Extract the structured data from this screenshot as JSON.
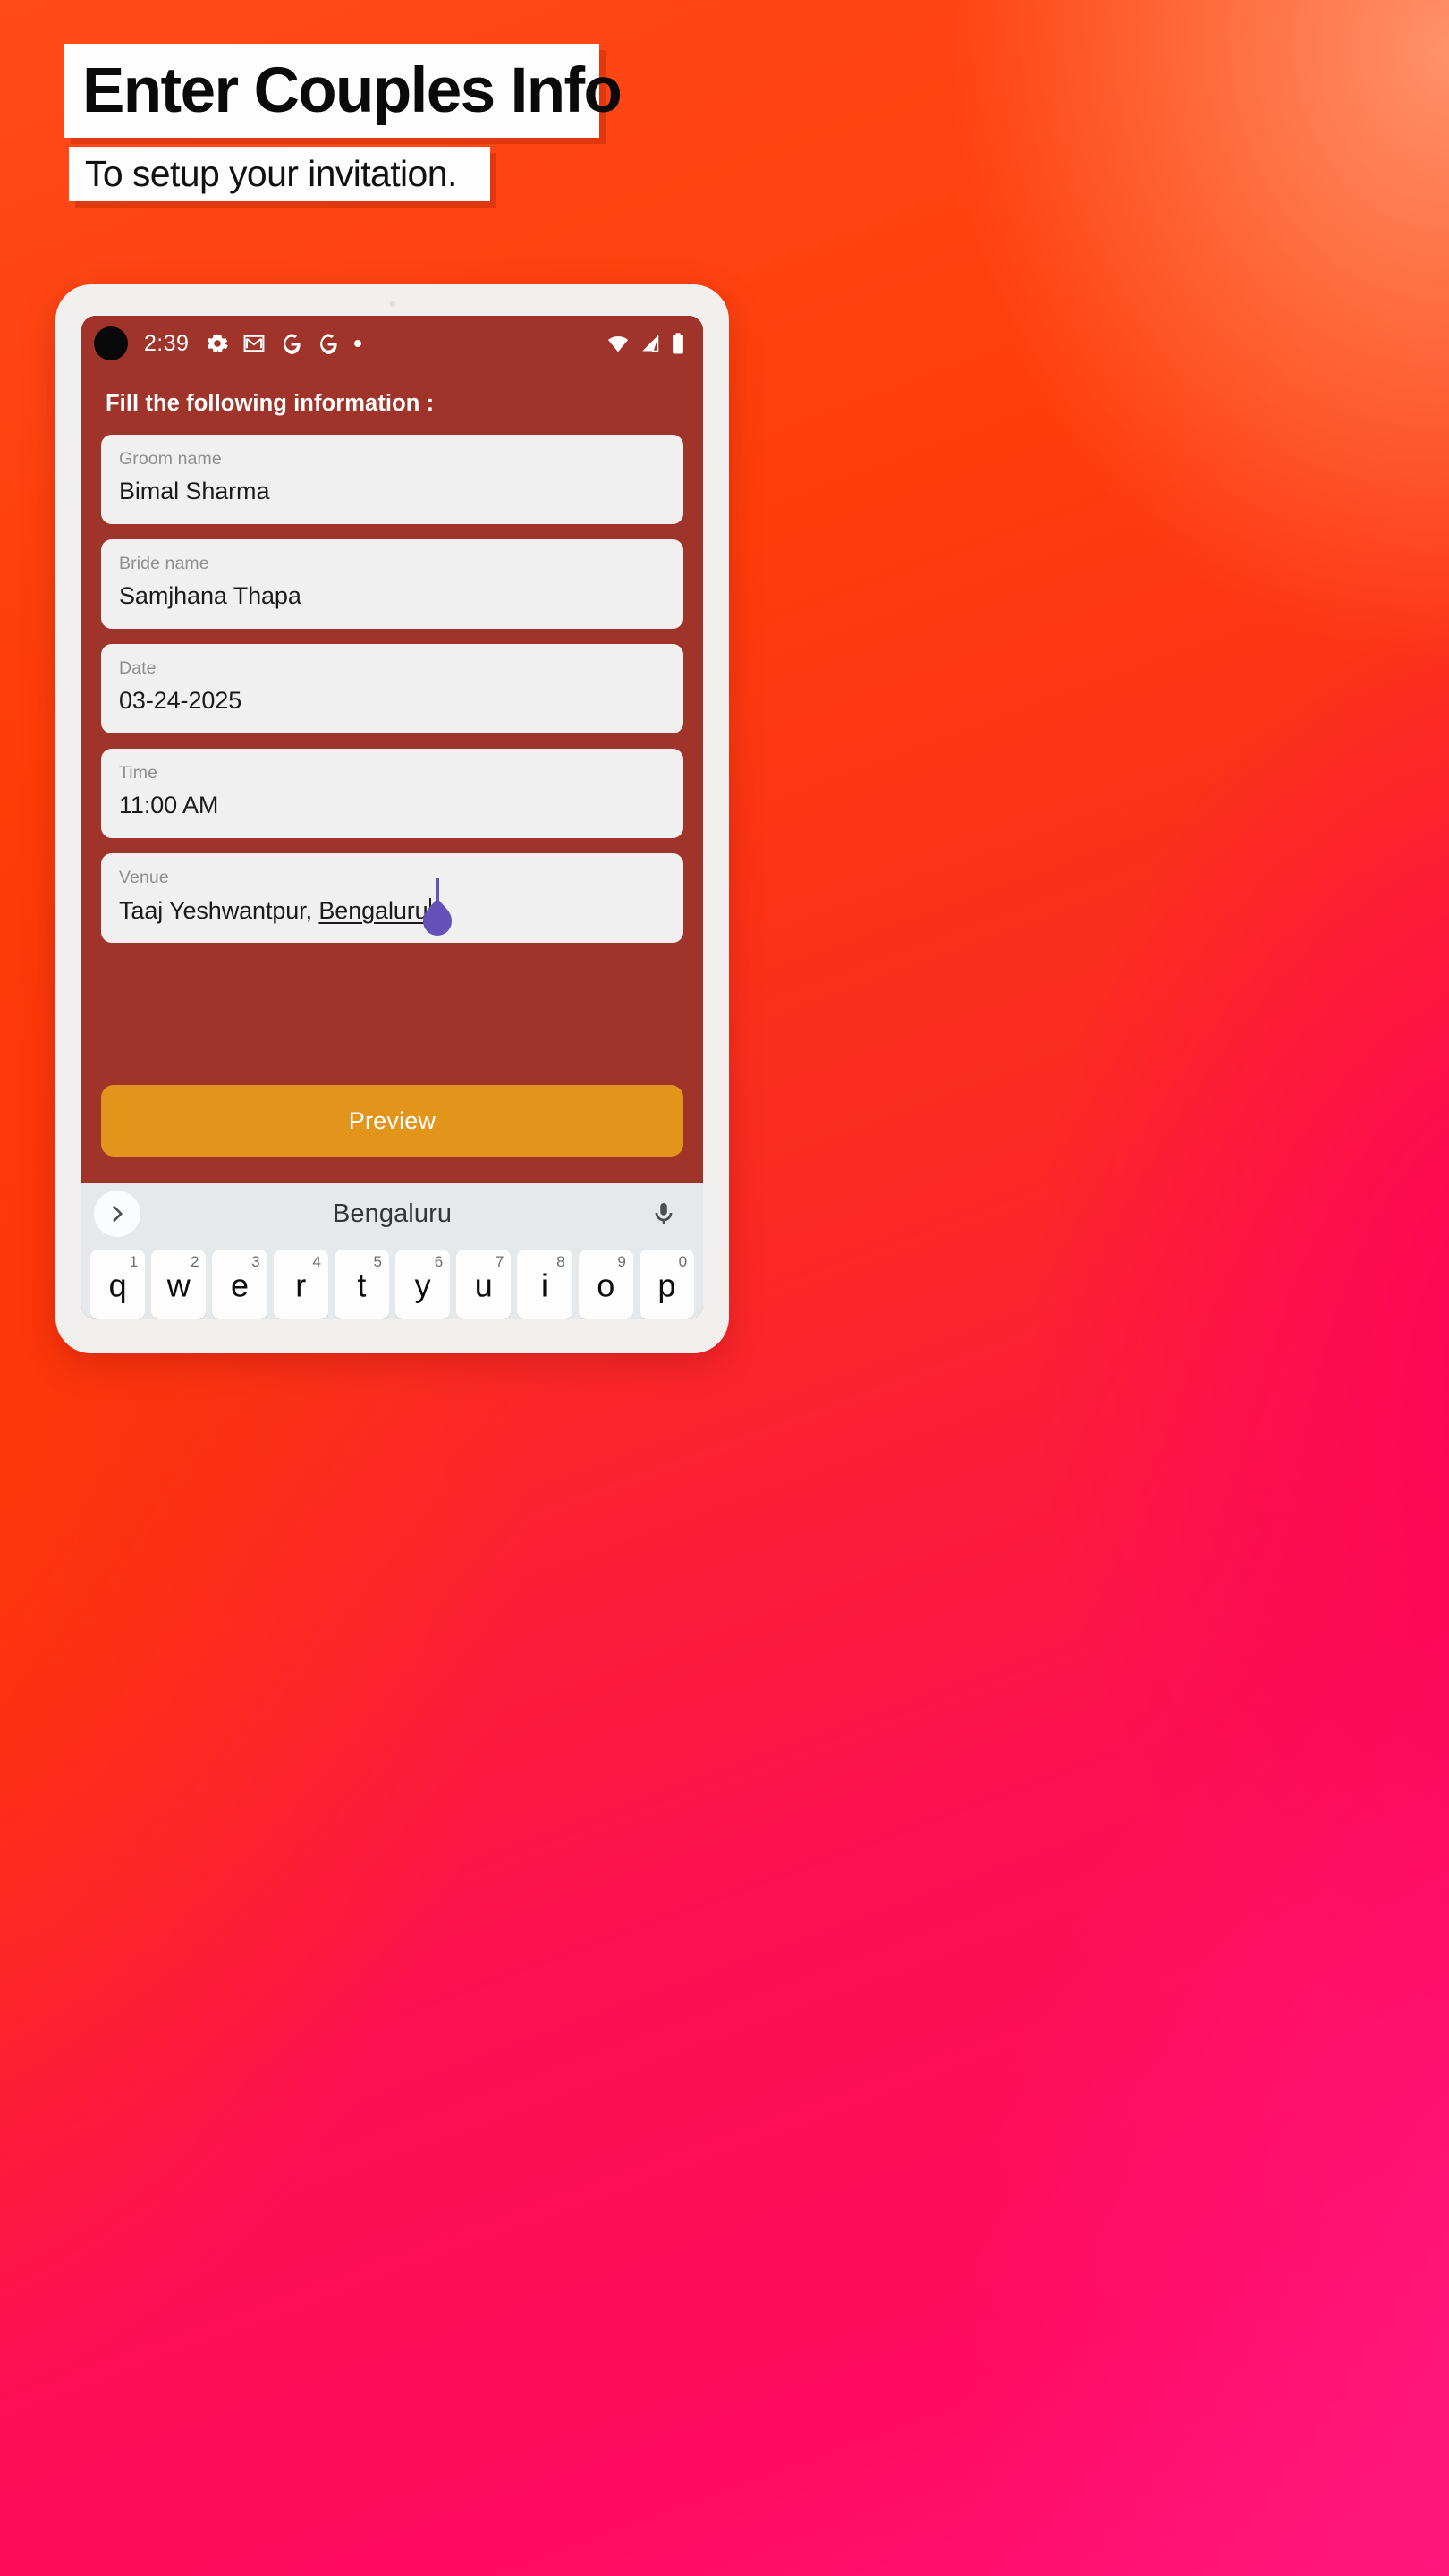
{
  "promo": {
    "title": "Enter Couples Info",
    "subtitle": "To setup your invitation.",
    "background_colors": {
      "orange": "#ff3d0a",
      "coral": "#ff966e",
      "pink": "#ff0a5f",
      "magenta": "#ff1478"
    }
  },
  "phone": {
    "status_bar": {
      "time": "2:39",
      "left_icons": [
        "gear-icon",
        "gmail-icon",
        "google-g-icon",
        "google-g-icon",
        "dot-icon"
      ],
      "right_icons": [
        "wifi-icon",
        "cellular-signal-icon",
        "battery-icon"
      ],
      "background_color": "#a0332a",
      "text_color": "#ffffff"
    },
    "app": {
      "header": "Fill the following information :",
      "background_color": "#a0332a",
      "fields": [
        {
          "label": "Groom name",
          "value": "Bimal Sharma",
          "composing": "",
          "caret": false
        },
        {
          "label": "Bride name",
          "value": "Samjhana Thapa",
          "composing": "",
          "caret": false
        },
        {
          "label": "Date",
          "value": "03-24-2025",
          "composing": "",
          "caret": false
        },
        {
          "label": "Time",
          "value": "11:00 AM",
          "composing": "",
          "caret": false
        },
        {
          "label": "Venue",
          "value": "Taaj Yeshwantpur, ",
          "composing": "Bengaluru",
          "caret": true
        }
      ],
      "preview_button": "Preview",
      "preview_button_color": "#e2941b",
      "text_handle_color": "#6552b8"
    },
    "keyboard": {
      "background_color": "#e6e9eb",
      "expand_icon": "chevron-right-icon",
      "suggestion": "Bengaluru",
      "mic_icon": "microphone-icon",
      "keys": [
        {
          "letter": "q",
          "num": "1"
        },
        {
          "letter": "w",
          "num": "2"
        },
        {
          "letter": "e",
          "num": "3"
        },
        {
          "letter": "r",
          "num": "4"
        },
        {
          "letter": "t",
          "num": "5"
        },
        {
          "letter": "y",
          "num": "6"
        },
        {
          "letter": "u",
          "num": "7"
        },
        {
          "letter": "i",
          "num": "8"
        },
        {
          "letter": "o",
          "num": "9"
        },
        {
          "letter": "p",
          "num": "0"
        }
      ]
    }
  }
}
